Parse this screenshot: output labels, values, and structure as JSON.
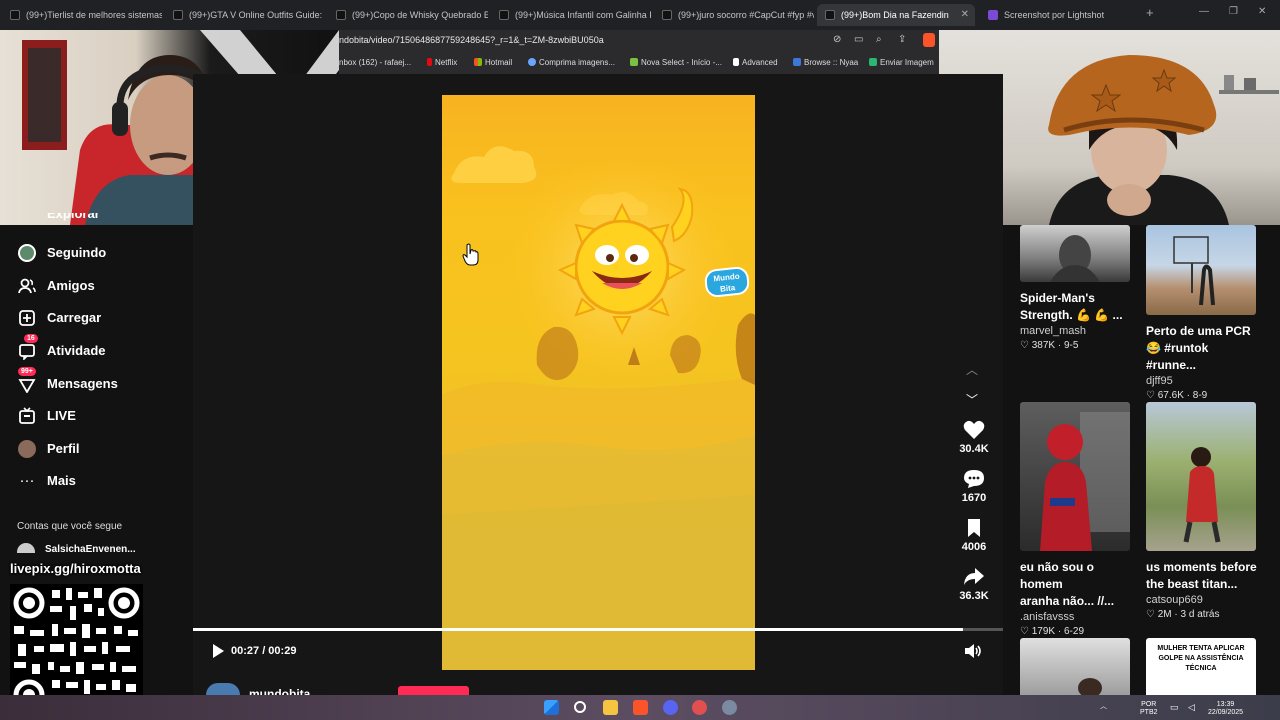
{
  "browser": {
    "tabs": [
      {
        "label": "(99+)Tierlist de melhores sistemas s"
      },
      {
        "label": "(99+)GTA V Online Outfits Guide: Ur"
      },
      {
        "label": "(99+)Copo de Whisky Quebrado Eq"
      },
      {
        "label": "(99+)Música Infantil com Galinha Pi"
      },
      {
        "label": "(99+)juro socorro #CapCut #fyp #vi"
      },
      {
        "label": "(99+)Bom Dia na Fazendinha: C"
      },
      {
        "label": "Screenshot por Lightshot"
      }
    ],
    "url": "ndobita/video/7150648687759248645?_r=1&_t=ZM-8zwbiBU050a",
    "bookmarks": [
      {
        "label": "nbox (162) - rafaej...",
        "color": "#c5c5c5"
      },
      {
        "label": "Netflix",
        "color": "#e50914"
      },
      {
        "label": "Hotmail",
        "color": "#f3b01b"
      },
      {
        "label": "Comprima imagens...",
        "color": "#6aa6ff"
      },
      {
        "label": "Nova Select - Início -...",
        "color": "#7ac143"
      },
      {
        "label": "Advanced",
        "color": "#ffffff"
      },
      {
        "label": "Browse :: Nyaa",
        "color": "#3c78d8"
      },
      {
        "label": "Enviar Imagem",
        "color": "#2bb673"
      }
    ]
  },
  "sidebar": {
    "partial_item": "Explorar",
    "items": [
      {
        "label": "Seguindo",
        "icon": "following-avatar-icon"
      },
      {
        "label": "Amigos",
        "icon": "friends-icon"
      },
      {
        "label": "Carregar",
        "icon": "upload-icon"
      },
      {
        "label": "Atividade",
        "icon": "activity-icon",
        "badge": "16"
      },
      {
        "label": "Mensagens",
        "icon": "messages-icon",
        "badge": "99+"
      },
      {
        "label": "LIVE",
        "icon": "live-icon"
      },
      {
        "label": "Perfil",
        "icon": "profile-avatar-icon"
      },
      {
        "label": "Mais",
        "icon": "more-icon"
      }
    ],
    "following_heading": "Contas que você segue",
    "following_user": "SalsichaEnvenen..."
  },
  "overlay": {
    "livepix": "livepix.gg/hiroxmotta"
  },
  "video": {
    "brand_logo_line1": "Mundo",
    "brand_logo_line2": "Bita",
    "time": "00:27 / 00:29",
    "progress": 0.95,
    "channel": "mundobita",
    "colors": {
      "accent": "#fe2c55",
      "sun": "#f9c21e"
    }
  },
  "actions": {
    "likes": "30.4K",
    "comments": "1670",
    "saves": "4006",
    "shares": "36.3K"
  },
  "recommendations": [
    {
      "title_line1": "Spider-Man's",
      "title_line2": "Strength. 💪 💪 ...",
      "author": "marvel_mash",
      "likes": "387K",
      "date": "9-5"
    },
    {
      "title_line1": "Perto de uma PCR",
      "title_line2": "😂 #runtok #runne...",
      "author": "djff95",
      "likes": "67.6K",
      "date": "8-9"
    },
    {
      "title_line1": "eu não sou o homem",
      "title_line2": "aranha não... //...",
      "author": ".anisfavsss",
      "likes": "179K",
      "date": "6-29"
    },
    {
      "title_line1": "us moments before",
      "title_line2": "the beast titan...",
      "author": "catsoup669",
      "likes": "2M",
      "date": "3 d atrás"
    },
    {
      "thumb_text": "MULHER TENTA APLICAR GOLPE NA ASSISTÊNCIA TÉCNICA"
    }
  ],
  "taskbar": {
    "lang_line1": "POR",
    "lang_line2": "PTB2",
    "time": "13:39",
    "date": "22/09/2025"
  }
}
